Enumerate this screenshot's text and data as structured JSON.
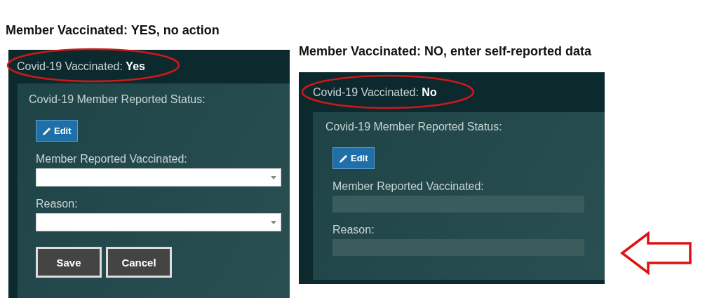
{
  "panels": [
    {
      "caption": "Member Vaccinated: YES, no action",
      "header": "Covid-19 Vaccinated: **Yes**",
      "section_title": "Covid-19 Member Reported Status:",
      "edit_button": "Edit",
      "fields": [
        {
          "label": "Member Reported Vaccinated:",
          "kind": "dropdown"
        },
        {
          "label": "Reason:",
          "kind": "dropdown"
        }
      ],
      "buttons": [
        "Save",
        "Cancel"
      ]
    },
    {
      "caption": "Member Vaccinated: NO, enter self-reported data",
      "header": "Covid-19 Vaccinated: **No**",
      "section_title": "Covid-19 Member Reported Status:",
      "edit_button": "Edit",
      "fields": [
        {
          "label": "Member Reported Vaccinated:",
          "kind": "disabled"
        },
        {
          "label": "Reason:",
          "kind": "disabled"
        }
      ]
    }
  ]
}
